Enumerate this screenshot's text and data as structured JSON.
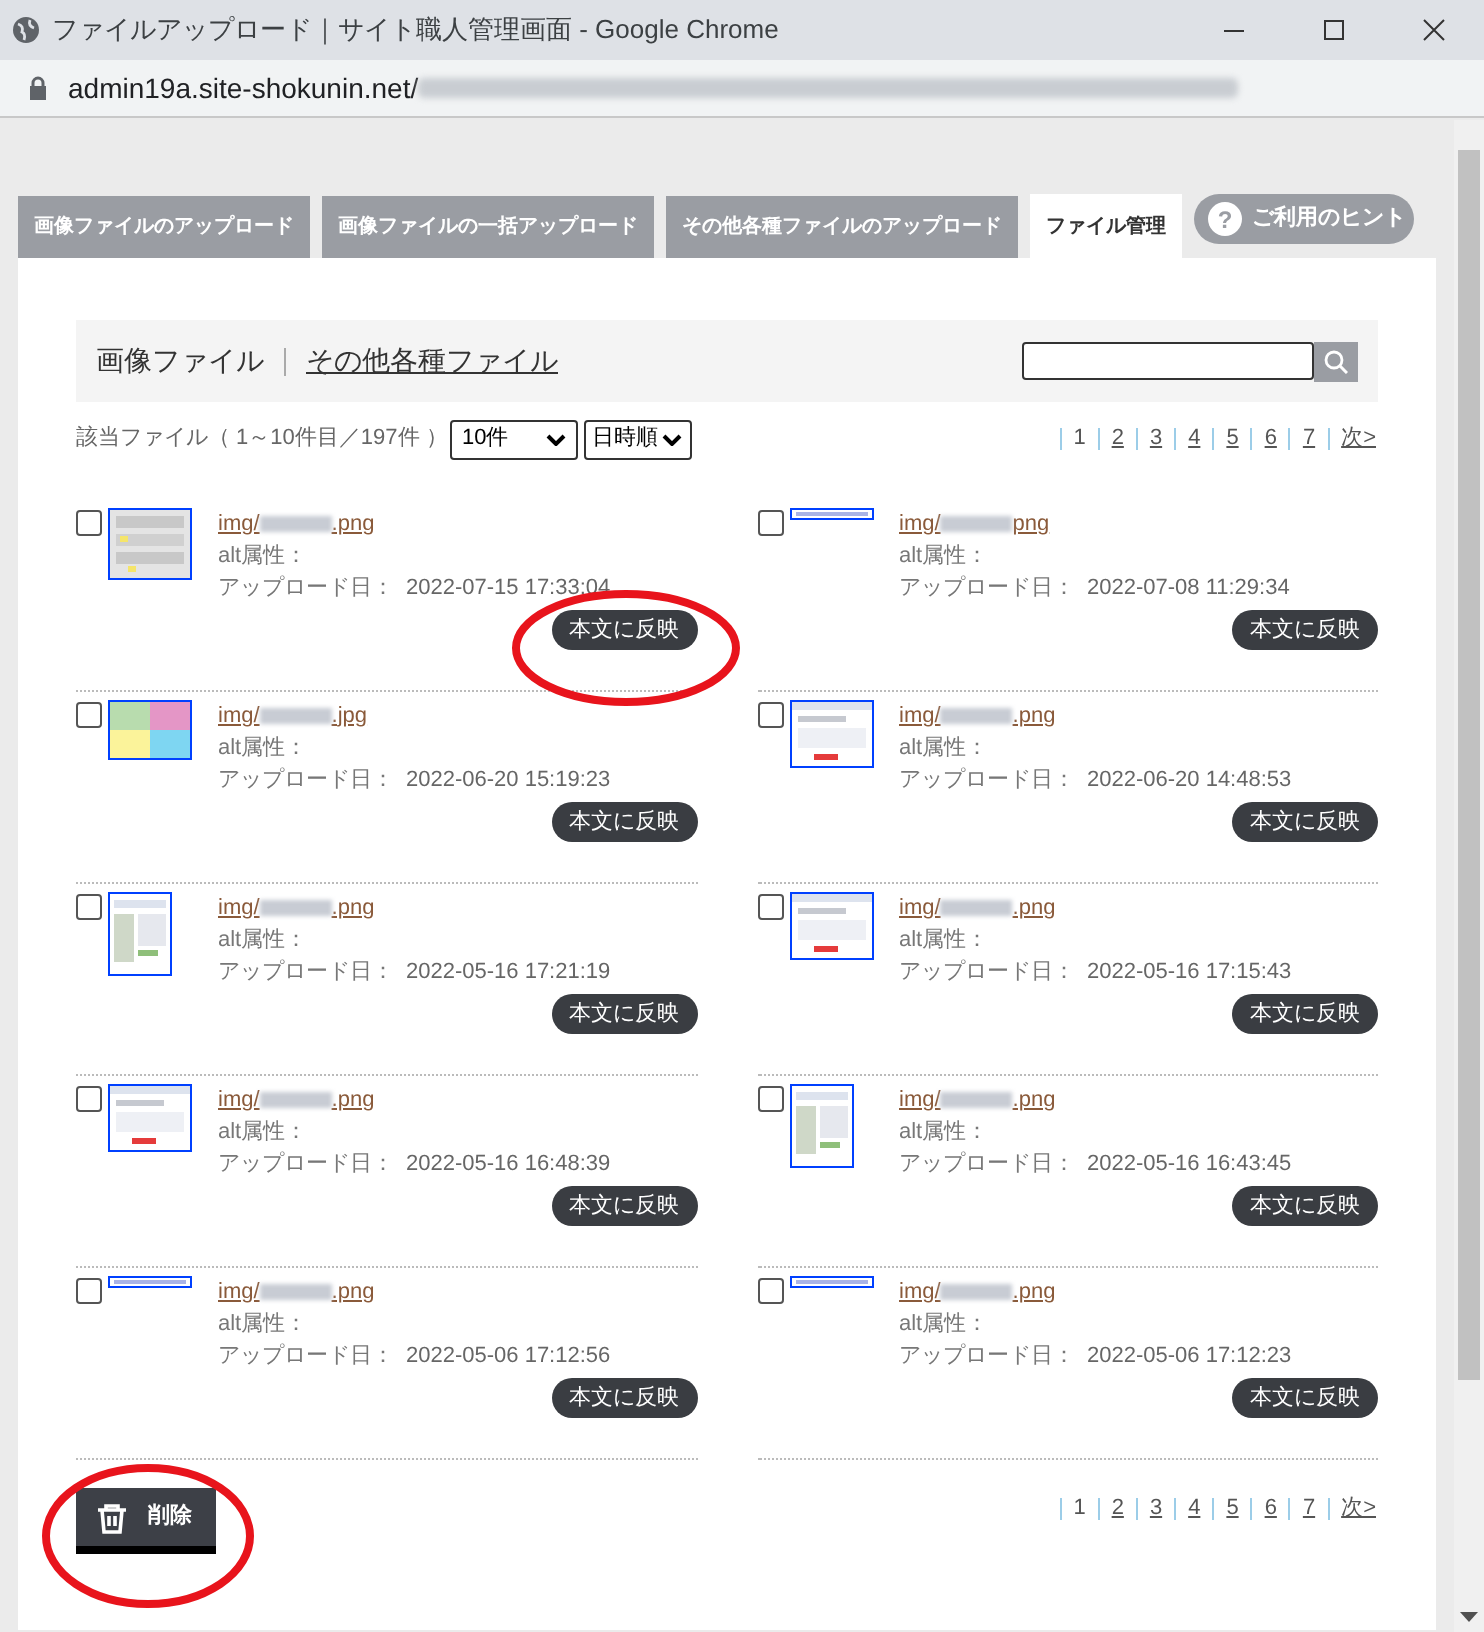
{
  "window": {
    "title": "ファイルアップロード｜サイト職人管理画面 - Google Chrome",
    "url": "admin19a.site-shokunin.net/"
  },
  "tabs": [
    {
      "label": "画像ファイルのアップロード",
      "selected": false
    },
    {
      "label": "画像ファイルの一括アップロード",
      "selected": false
    },
    {
      "label": "その他各種ファイルのアップロード",
      "selected": false
    },
    {
      "label": "ファイル管理",
      "selected": true
    }
  ],
  "hint_button": {
    "icon": "?",
    "label": "ご利用のヒント"
  },
  "filter": {
    "current": "画像ファイル",
    "other": "その他各種ファイル"
  },
  "summary": "該当ファイル（ 1～10件目／197件 ）",
  "per_page": "10件",
  "sort": "日時順",
  "pager_top": [
    {
      "label": "1",
      "selected": true
    },
    {
      "label": "2",
      "selected": false
    },
    {
      "label": "3",
      "selected": false
    },
    {
      "label": "4",
      "selected": false
    },
    {
      "label": "5",
      "selected": false
    },
    {
      "label": "6",
      "selected": false
    },
    {
      "label": "7",
      "selected": false
    },
    {
      "label": "次>",
      "selected": false
    }
  ],
  "pager_bottom": [
    {
      "label": "1",
      "selected": true
    },
    {
      "label": "2",
      "selected": false
    },
    {
      "label": "3",
      "selected": false
    },
    {
      "label": "4",
      "selected": false
    },
    {
      "label": "5",
      "selected": false
    },
    {
      "label": "6",
      "selected": false
    },
    {
      "label": "7",
      "selected": false
    },
    {
      "label": "次>",
      "selected": false
    }
  ],
  "files": [
    {
      "checked": false,
      "name_start": "img/",
      "name_end": ".png",
      "alt": "alt属性：",
      "date_label": "アップロード日：",
      "date": "2022-07-15 17:33:04",
      "button": "本文に反映"
    },
    {
      "checked": false,
      "name_start": "img/",
      "name_end": "png",
      "alt": "alt属性：",
      "date_label": "アップロード日：",
      "date": "2022-07-08 11:29:34",
      "button": "本文に反映"
    },
    {
      "checked": false,
      "name_start": "img/",
      "name_end": ".jpg",
      "alt": "alt属性：",
      "date_label": "アップロード日：",
      "date": "2022-06-20 15:19:23",
      "button": "本文に反映"
    },
    {
      "checked": false,
      "name_start": "img/",
      "name_end": ".png",
      "alt": "alt属性：",
      "date_label": "アップロード日：",
      "date": "2022-06-20 14:48:53",
      "button": "本文に反映"
    },
    {
      "checked": false,
      "name_start": "img/",
      "name_end": ".png",
      "alt": "alt属性：",
      "date_label": "アップロード日：",
      "date": "2022-05-16 17:21:19",
      "button": "本文に反映"
    },
    {
      "checked": false,
      "name_start": "img/",
      "name_end": ".png",
      "alt": "alt属性：",
      "date_label": "アップロード日：",
      "date": "2022-05-16 17:15:43",
      "button": "本文に反映"
    },
    {
      "checked": false,
      "name_start": "img/",
      "name_end": ".png",
      "alt": "alt属性：",
      "date_label": "アップロード日：",
      "date": "2022-05-16 16:48:39",
      "button": "本文に反映"
    },
    {
      "checked": false,
      "name_start": "img/",
      "name_end": ".png",
      "alt": "alt属性：",
      "date_label": "アップロード日：",
      "date": "2022-05-16 16:43:45",
      "button": "本文に反映"
    },
    {
      "checked": false,
      "name_start": "img/",
      "name_end": ".png",
      "alt": "alt属性：",
      "date_label": "アップロード日：",
      "date": "2022-05-06 17:12:56",
      "button": "本文に反映"
    },
    {
      "checked": false,
      "name_start": "img/",
      "name_end": ".png",
      "alt": "alt属性：",
      "date_label": "アップロード日：",
      "date": "2022-05-06 17:12:23",
      "button": "本文に反映"
    }
  ],
  "delete_button": "削除"
}
